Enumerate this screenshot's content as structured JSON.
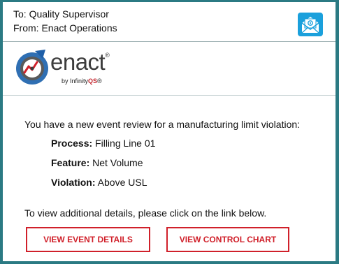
{
  "header": {
    "to_line": "To: Quality Supervisor",
    "from_line": "From: Enact Operations",
    "icon": "open-envelope-email-icon"
  },
  "brand": {
    "wordmark": "enact",
    "trademark": "®",
    "by_text": "by Infinity",
    "qs_text": "QS",
    "by_reg": "®",
    "logo_icon": "enact-gauge-logo",
    "colors": {
      "accent_red": "#d0202a",
      "frame_teal": "#2b7a83",
      "logo_blue": "#2f6fb3"
    }
  },
  "body": {
    "intro": "You have a new event review for a manufacturing limit violation:",
    "details": [
      {
        "label": "Process:",
        "value": "Filling Line 01"
      },
      {
        "label": "Feature:",
        "value": "Net Volume"
      },
      {
        "label": "Violation:",
        "value": "Above USL"
      }
    ],
    "instruction": "To view additional details, please click on the link below."
  },
  "actions": {
    "view_event_details": "VIEW EVENT DETAILS",
    "view_control_chart": "VIEW CONTROL CHART"
  }
}
